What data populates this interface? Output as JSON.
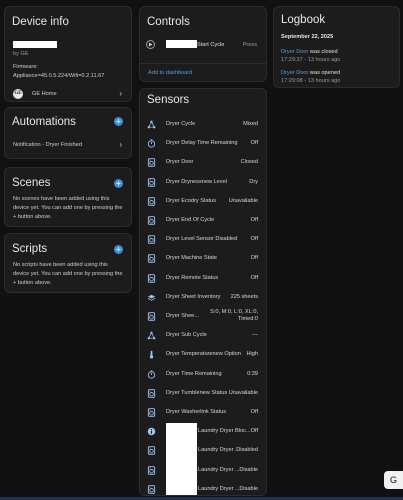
{
  "device_info": {
    "title": "Device info",
    "by": "by GE",
    "firmware_label": "Firmware:",
    "firmware_value": "Appliance=45.0.5.224/Wifi=0.2.11.67",
    "integration": "GE Home",
    "integration_icon": "ge-logo-icon"
  },
  "automations": {
    "title": "Automations",
    "items": [
      {
        "label": "Notification - Dryer Finished"
      }
    ]
  },
  "scenes": {
    "title": "Scenes",
    "empty_text": "No scenes have been added using this device yet. You can add one by pressing the + button above."
  },
  "scripts": {
    "title": "Scripts",
    "empty_text": "No scripts have been added using this device yet. You can add one by pressing the + button above."
  },
  "controls": {
    "title": "Controls",
    "item_label": "Start Cycle",
    "item_action": "Press",
    "add_link": "Add to dashboard"
  },
  "sensors": {
    "title": "Sensors",
    "items": [
      {
        "name": "Dryer Cycle",
        "value": "Mixed",
        "icon": "cycle-icon"
      },
      {
        "name": "Dryer Delay Time Remaining",
        "value": "Off",
        "icon": "timer-icon"
      },
      {
        "name": "Dryer Door",
        "value": "Closed",
        "icon": "dryer-icon"
      },
      {
        "name": "Dryer Drynessnew Level",
        "value": "Dry",
        "icon": "dryer-icon"
      },
      {
        "name": "Dryer Ecodry Status",
        "value": "Unavailable",
        "icon": "dryer-icon"
      },
      {
        "name": "Dryer End Of Cycle",
        "value": "Off",
        "icon": "dryer-icon"
      },
      {
        "name": "Dryer Level Sensor Disabled",
        "value": "Off",
        "icon": "dryer-icon"
      },
      {
        "name": "Dryer Machine State",
        "value": "Off",
        "icon": "dryer-icon"
      },
      {
        "name": "Dryer Remote Status",
        "value": "Off",
        "icon": "dryer-icon"
      },
      {
        "name": "Dryer Sheet Inventory",
        "value": "225 sheets",
        "icon": "layers-icon"
      },
      {
        "name": "Dryer Shee...",
        "value": "S:0, M:0, L:0, XL:0, Timed:0",
        "icon": "dryer-icon"
      },
      {
        "name": "Dryer Sub Cycle",
        "value": "—",
        "icon": "cycle-icon"
      },
      {
        "name": "Dryer Temperaturenew Option",
        "value": "High",
        "icon": "thermometer-icon"
      },
      {
        "name": "Dryer Time Remaining",
        "value": "0:39",
        "icon": "timer-icon"
      },
      {
        "name": "Dryer Tumblenew Status",
        "value": "Unavailable",
        "icon": "dryer-icon"
      },
      {
        "name": "Dryer Washerlink Status",
        "value": "Off",
        "icon": "dryer-icon"
      },
      {
        "name": "Laundry Dryer Bloc...",
        "value": "Off",
        "icon": "info-icon"
      },
      {
        "name": "Laundry Dryer ...",
        "value": "Disabled",
        "icon": "dryer-icon"
      },
      {
        "name": "Laundry Dryer ...",
        "value": "Disable",
        "icon": "dryer-icon"
      },
      {
        "name": "Laundry Dryer ...",
        "value": "Disable",
        "icon": "dryer-icon"
      }
    ]
  },
  "logbook": {
    "title": "Logbook",
    "date": "September 22, 2025",
    "entries": [
      {
        "entity": "Dryer Door",
        "text": "was closed",
        "time": "17:29:37 - 13 hours ago"
      },
      {
        "entity": "Dryer Door",
        "text": "was opened",
        "time": "17:29:08 - 13 hours ago"
      }
    ]
  },
  "floating_button_label": "G"
}
